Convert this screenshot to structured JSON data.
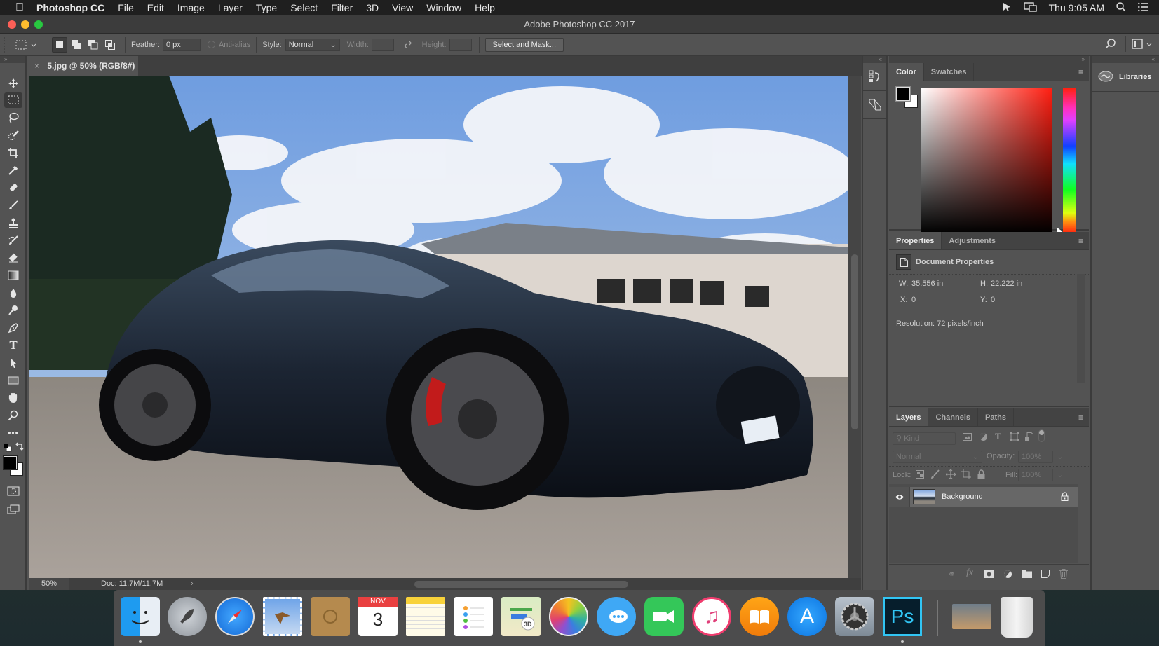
{
  "menubar": {
    "app_name": "Photoshop CC",
    "items": [
      "File",
      "Edit",
      "Image",
      "Layer",
      "Type",
      "Select",
      "Filter",
      "3D",
      "View",
      "Window",
      "Help"
    ],
    "clock": "Thu 9:05 AM",
    "icons": [
      "apple-icon",
      "cursor-icon",
      "display-mirror-icon",
      "spotlight-icon",
      "notification-center-icon"
    ]
  },
  "window": {
    "title": "Adobe Photoshop CC 2017",
    "traffic_lights": {
      "close": "#fc5f57",
      "minimize": "#fdbc2e",
      "zoom": "#28c840"
    }
  },
  "options_bar": {
    "feather_label": "Feather:",
    "feather_value": "0 px",
    "anti_alias_label": "Anti-alias",
    "style_label": "Style:",
    "style_value": "Normal",
    "width_label": "Width:",
    "height_label": "Height:",
    "select_mask_label": "Select and Mask..."
  },
  "document": {
    "tab_title": "5.jpg @ 50% (RGB/8#)",
    "zoom": "50%",
    "doc_size": "Doc: 11.7M/11.7M"
  },
  "tools": [
    "move-tool",
    "rectangular-marquee-tool",
    "lasso-tool",
    "quick-selection-tool",
    "crop-tool",
    "eyedropper-tool",
    "spot-healing-brush-tool",
    "brush-tool",
    "clone-stamp-tool",
    "history-brush-tool",
    "eraser-tool",
    "gradient-tool",
    "blur-tool",
    "dodge-tool",
    "pen-tool",
    "type-tool",
    "path-selection-tool",
    "rectangle-tool",
    "hand-tool",
    "zoom-tool",
    "edit-toolbar",
    "default-colors",
    "swap-colors",
    "foreground-color",
    "background-color",
    "quick-mask",
    "screen-mode"
  ],
  "colors": {
    "foreground": "#000000",
    "background": "#ffffff"
  },
  "panels": {
    "color": {
      "tabs": [
        "Color",
        "Swatches"
      ],
      "active": 0
    },
    "properties": {
      "tabs": [
        "Properties",
        "Adjustments"
      ],
      "active": 0,
      "section_title": "Document Properties",
      "w_label": "W:",
      "w_value": "35.556 in",
      "h_label": "H:",
      "h_value": "22.222 in",
      "x_label": "X:",
      "x_value": "0",
      "y_label": "Y:",
      "y_value": "0",
      "resolution": "Resolution: 72 pixels/inch"
    },
    "layers": {
      "tabs": [
        "Layers",
        "Channels",
        "Paths"
      ],
      "active": 0,
      "filter_label": "Kind",
      "blend_mode": "Normal",
      "opacity_label": "Opacity:",
      "opacity_value": "100%",
      "lock_label": "Lock:",
      "fill_label": "Fill:",
      "fill_value": "100%",
      "layer_list": [
        {
          "name": "Background",
          "visible": true,
          "locked": true
        }
      ]
    },
    "libraries": {
      "label": "Libraries"
    }
  },
  "dock": {
    "apps": [
      "Finder",
      "Launchpad",
      "Safari",
      "Mail",
      "Contacts",
      "Calendar",
      "Notes",
      "Reminders",
      "Maps",
      "Photos",
      "Messages",
      "FaceTime",
      "iTunes",
      "iBooks",
      "App Store",
      "System Preferences",
      "Photoshop CC",
      "Downloads",
      "Trash"
    ],
    "calendar_month": "NOV",
    "calendar_day": "3",
    "ps_label": "Ps"
  }
}
